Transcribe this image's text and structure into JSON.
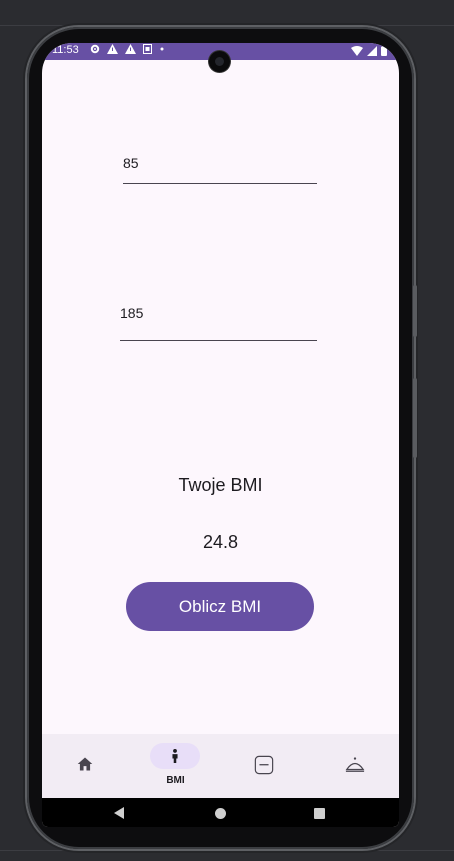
{
  "status_bar": {
    "time": "11:53",
    "left_icons": [
      "gear-icon",
      "warning-icon",
      "warning-icon",
      "sim-icon",
      "dot-icon"
    ],
    "right_icons": [
      "wifi-icon",
      "signal-icon",
      "battery-icon"
    ],
    "color": "#6750a4"
  },
  "form": {
    "weight_value": "85",
    "height_value": "185"
  },
  "result": {
    "label": "Twoje BMI",
    "value": "24.8"
  },
  "calculate_button": {
    "label": "Oblicz BMI"
  },
  "bottom_nav": {
    "items": [
      {
        "icon": "home-icon",
        "label": "",
        "selected": false
      },
      {
        "icon": "person-icon",
        "label": "BMI",
        "selected": true
      },
      {
        "icon": "kcal-icon",
        "label": "",
        "selected": false
      },
      {
        "icon": "food-cloche-icon",
        "label": "",
        "selected": false
      }
    ]
  },
  "colors": {
    "primary": "#6750a4",
    "background": "#fdf7fd",
    "nav_background": "#f2ecf4",
    "selected_pill": "#e8def8"
  }
}
